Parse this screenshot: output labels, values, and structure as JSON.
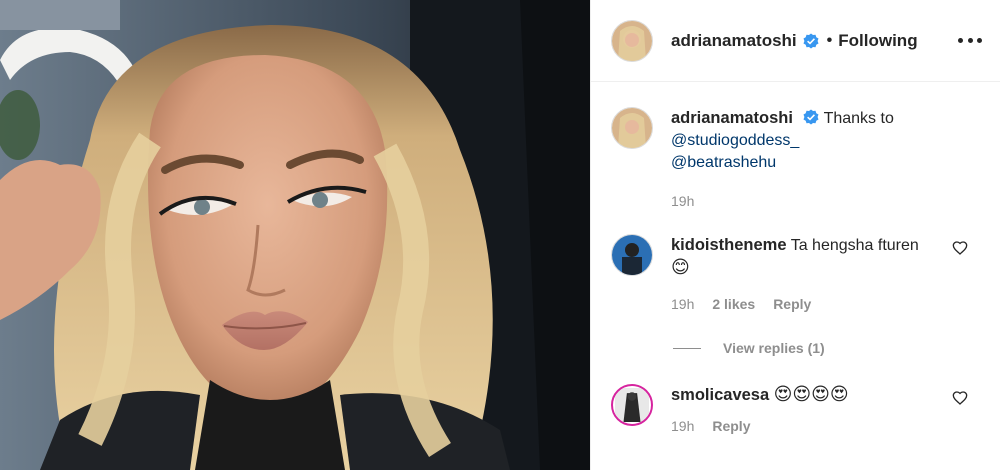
{
  "header": {
    "username": "adrianamatoshi",
    "separator": "•",
    "follow_label": "Following",
    "more_icon": "more-horizontal-icon"
  },
  "caption": {
    "username": "adrianamatoshi",
    "text": "Thanks to",
    "mentions": [
      "@studiogoddess_",
      "@beatrashehu"
    ],
    "time": "19h"
  },
  "comments": [
    {
      "username": "kidoistheneme",
      "text": "Ta hengsha fturen",
      "emoji": "😊",
      "time": "19h",
      "likes": "2 likes",
      "reply_label": "Reply",
      "view_replies": "View replies (1)"
    },
    {
      "username": "smolicavesa",
      "text": "",
      "emoji": "😍😍😍😍",
      "time": "19h",
      "reply_label": "Reply"
    }
  ],
  "colors": {
    "text": "#262626",
    "muted": "#8e8e8e",
    "link": "#00376b",
    "verified": "#3897f0",
    "border": "#efefef"
  }
}
